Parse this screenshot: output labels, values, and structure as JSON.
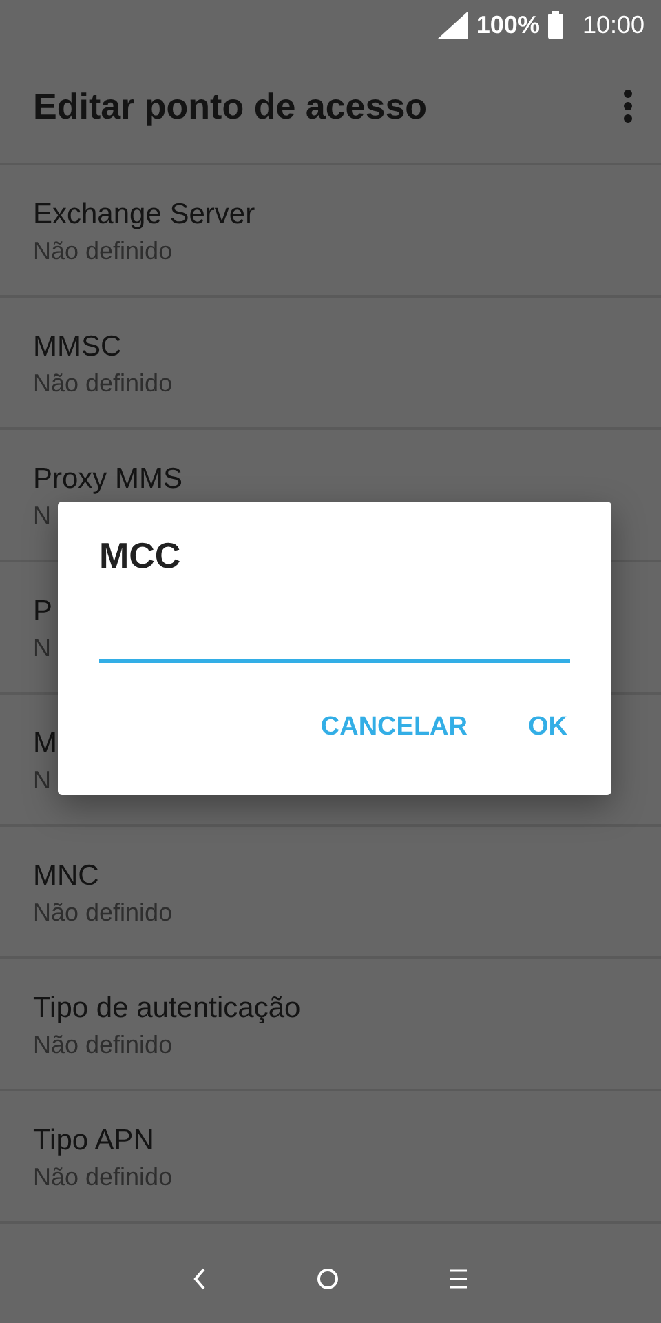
{
  "status_bar": {
    "battery": "100%",
    "time": "10:00"
  },
  "app_bar": {
    "title": "Editar ponto de acesso"
  },
  "rows": [
    {
      "title": "Exchange Server",
      "subtitle": "Não definido"
    },
    {
      "title": "MMSC",
      "subtitle": "Não definido"
    },
    {
      "title": "Proxy MMS",
      "subtitle": "N"
    },
    {
      "title": "P",
      "subtitle": "N"
    },
    {
      "title": "M",
      "subtitle": "N"
    },
    {
      "title": "MNC",
      "subtitle": "Não definido"
    },
    {
      "title": "Tipo de autenticação",
      "subtitle": "Não definido"
    },
    {
      "title": "Tipo APN",
      "subtitle": "Não definido"
    }
  ],
  "dialog": {
    "title": "MCC",
    "buttons": [
      "CANCELAR",
      "OK"
    ]
  }
}
